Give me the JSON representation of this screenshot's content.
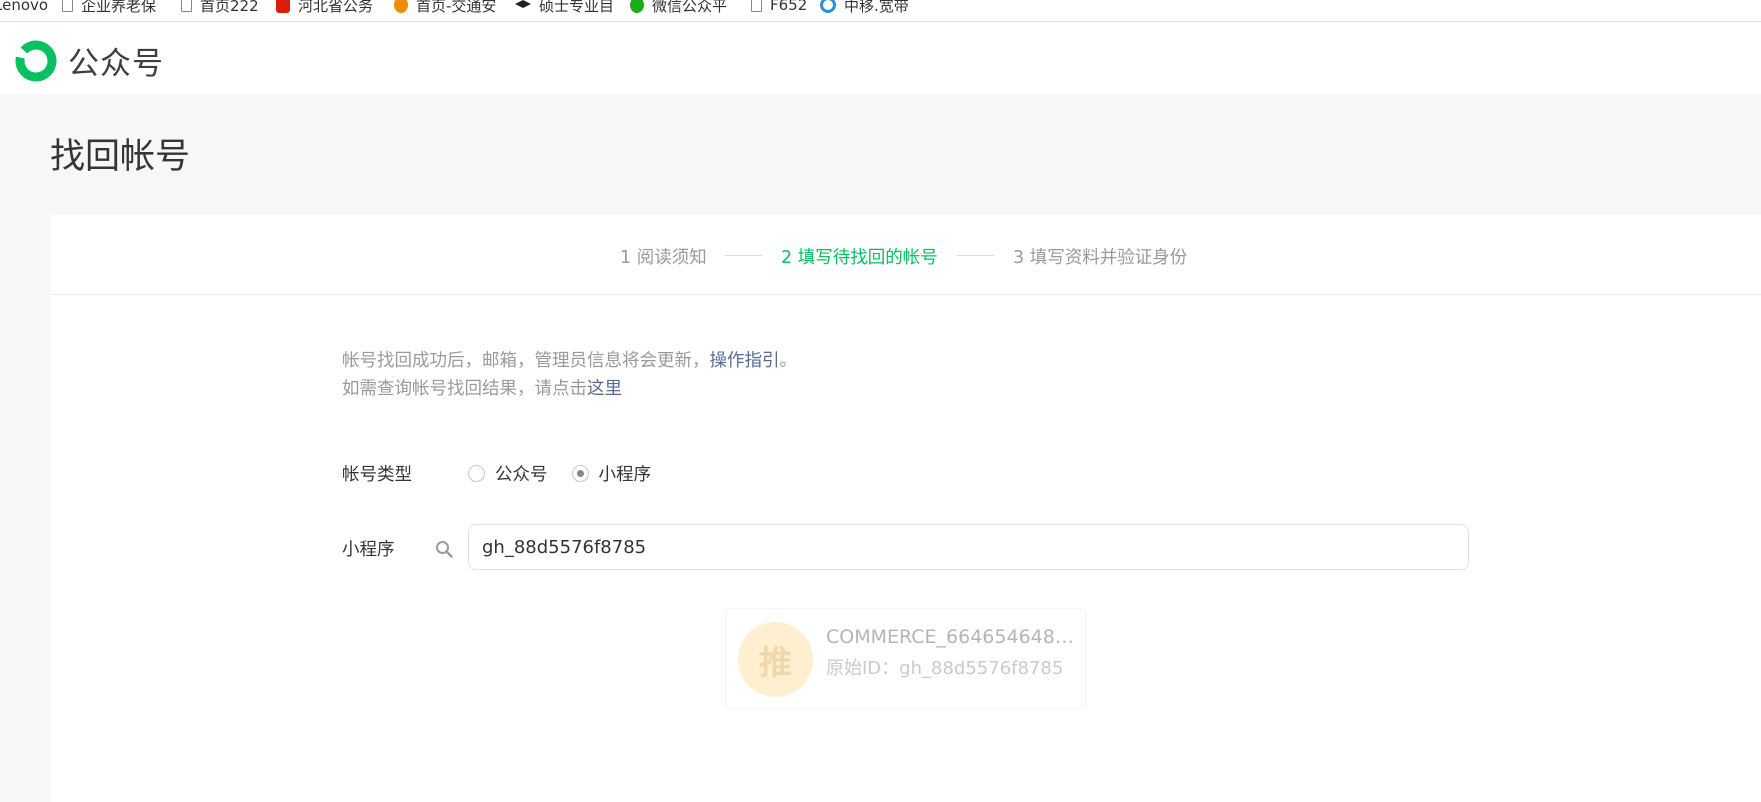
{
  "bookmarks": [
    {
      "label": "Lenovo",
      "icon": "none"
    },
    {
      "label": "企业养老保",
      "icon": "page-icon"
    },
    {
      "label": "首页222",
      "icon": "page-icon"
    },
    {
      "label": "河北省公务",
      "icon": "red-badge-icon"
    },
    {
      "label": "首页-交通安",
      "icon": "orange-badge-icon"
    },
    {
      "label": "硕士专业目",
      "icon": "graduation-cap-icon"
    },
    {
      "label": "微信公众平",
      "icon": "wechat-icon"
    },
    {
      "label": "F652",
      "icon": "page-icon"
    },
    {
      "label": "中移.宽带",
      "icon": "china-mobile-icon"
    }
  ],
  "header": {
    "app_name": "公众号",
    "brand_color": "#07c160"
  },
  "page": {
    "title": "找回帐号"
  },
  "steps": [
    {
      "label": "1 阅读须知",
      "active": false
    },
    {
      "label": "2 填写待找回的帐号",
      "active": true
    },
    {
      "label": "3 填写资料并验证身份",
      "active": false
    }
  ],
  "notice": {
    "line1_text": "帐号找回成功后，邮箱，管理员信息将会更新，",
    "line1_link": "操作指引",
    "line1_end": "。",
    "line2_text": "如需查询帐号找回结果，请点击",
    "line2_link": "这里"
  },
  "form": {
    "account_type_label": "帐号类型",
    "options": [
      {
        "label": "公众号",
        "checked": false
      },
      {
        "label": "小程序",
        "checked": true
      }
    ],
    "search_label": "小程序",
    "search_value": "gh_88d5576f8785"
  },
  "result": {
    "avatar_text": "推",
    "name": "COMMERCE_6646546488...",
    "id_text": "原始ID：gh_88d5576f8785"
  }
}
